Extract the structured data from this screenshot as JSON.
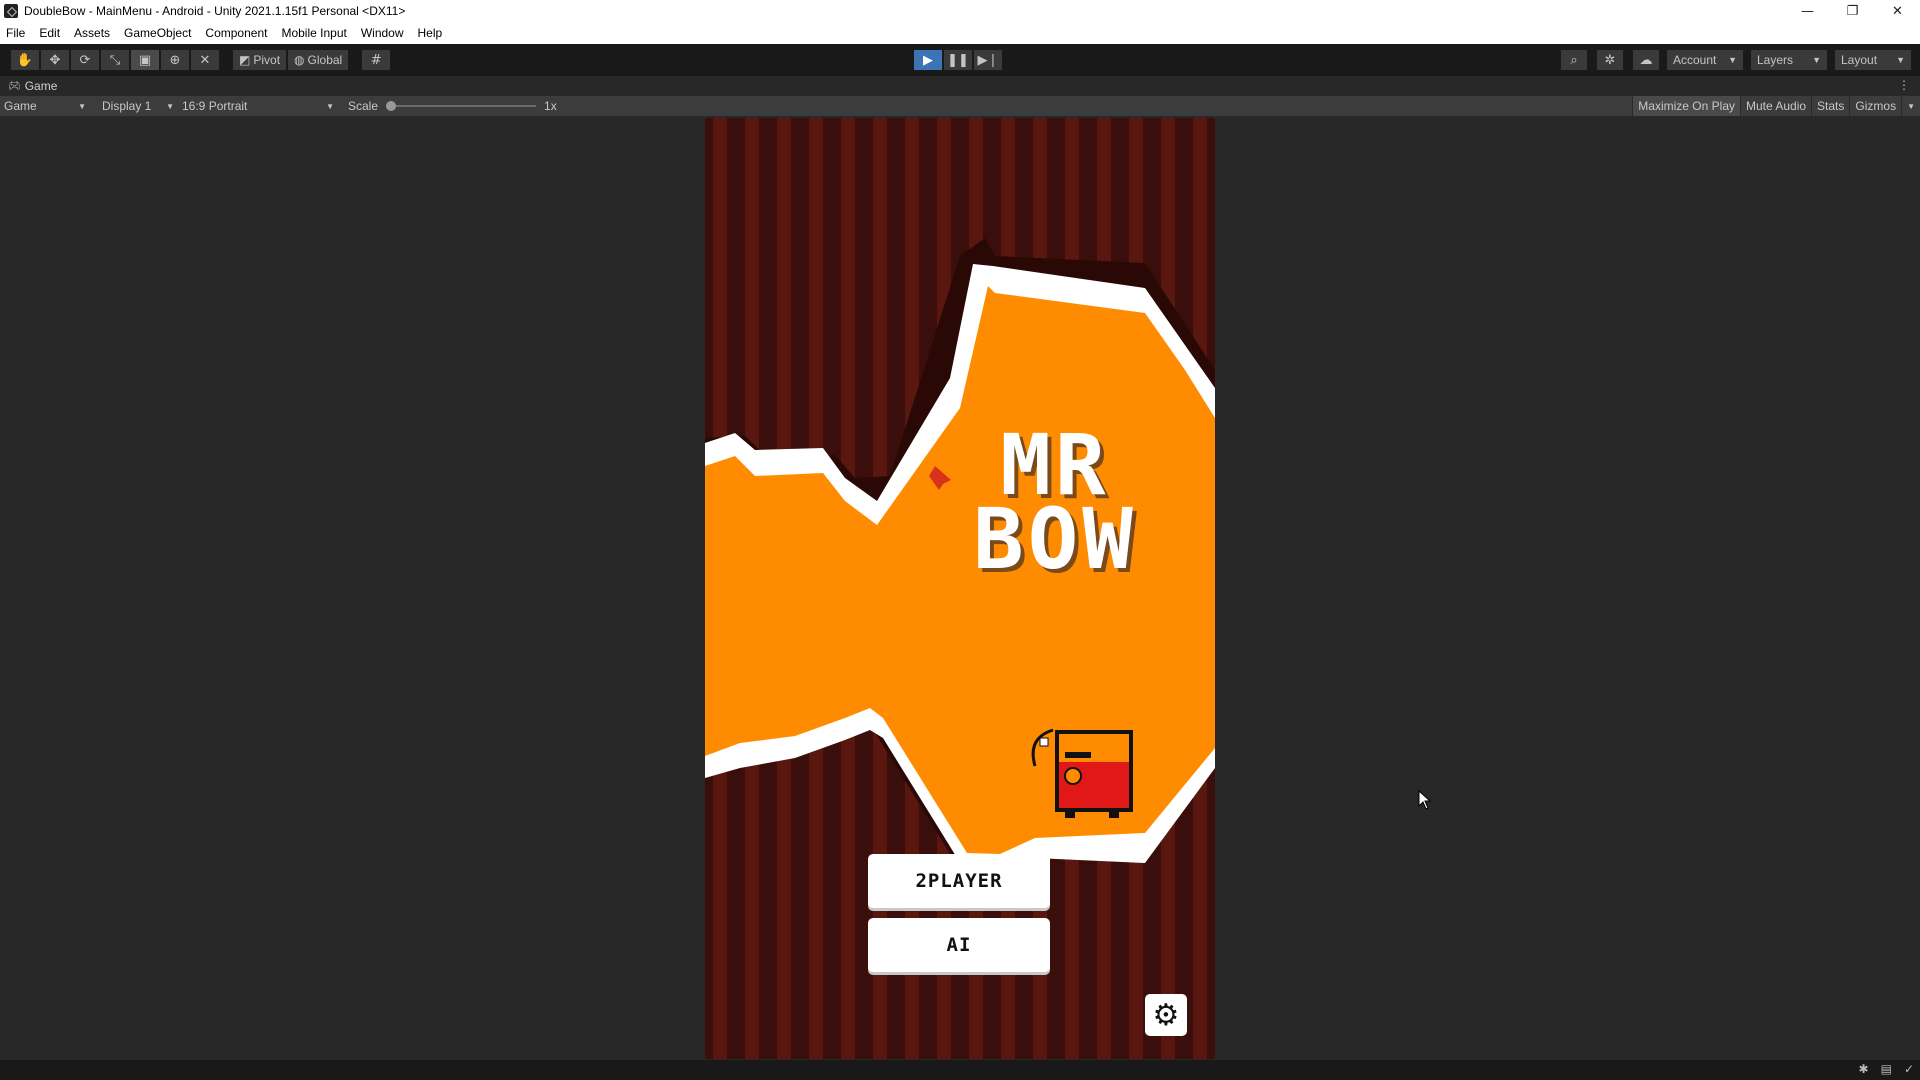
{
  "window": {
    "title": "DoubleBow - MainMenu - Android - Unity 2021.1.15f1 Personal <DX11>",
    "controls": {
      "minimize": "—",
      "restore": "❐",
      "close": "✕"
    }
  },
  "menu": {
    "items": [
      "File",
      "Edit",
      "Assets",
      "GameObject",
      "Component",
      "Mobile Input",
      "Window",
      "Help"
    ]
  },
  "toolbar": {
    "tools": [
      "hand-icon",
      "move-icon",
      "rotate-icon",
      "scale-icon",
      "rect-icon",
      "transform-icon",
      "custom-tool-icon"
    ],
    "pivot_label": "Pivot",
    "global_label": "Global",
    "account_label": "Account",
    "layers_label": "Layers",
    "layout_label": "Layout"
  },
  "tab": {
    "label": "Game"
  },
  "game_controls": {
    "view_label": "Game",
    "display_label": "Display 1",
    "aspect_label": "16:9 Portrait",
    "scale_label": "Scale",
    "scale_value": "1x",
    "scale_fraction": 0.0,
    "maximize_label": "Maximize On Play",
    "mute_label": "Mute Audio",
    "stats_label": "Stats",
    "gizmos_label": "Gizmos"
  },
  "game": {
    "title_line1": "MR",
    "title_line2": "BOW",
    "btn_2player": "2PLAYER",
    "btn_ai": "AI",
    "settings_icon": "gear-icon",
    "colors": {
      "background": "#3a0e0a",
      "stripe": "#5a1710",
      "orange": "#ff8c00",
      "white": "#ffffff",
      "character_red": "#e01818"
    }
  }
}
